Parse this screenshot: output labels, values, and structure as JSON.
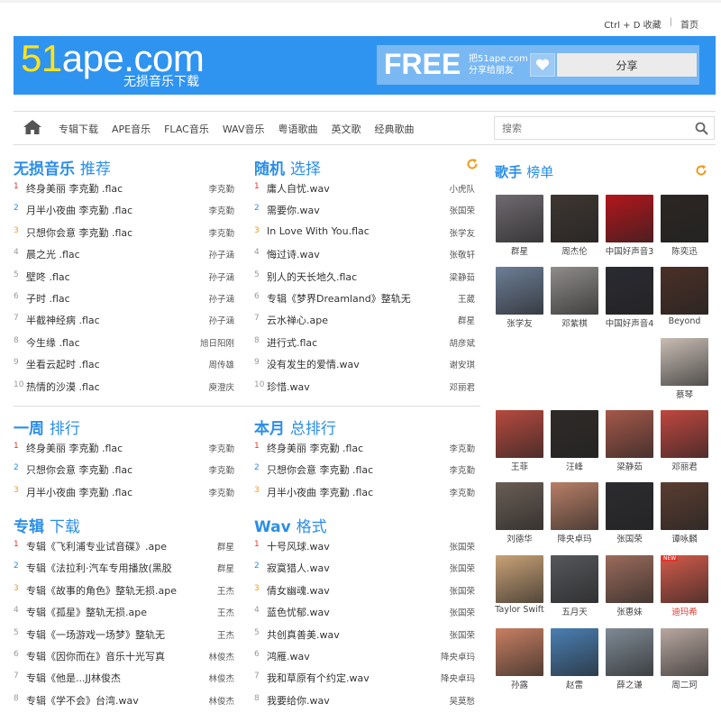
{
  "top_links": {
    "bookmark": "Ctrl + D 收藏",
    "sep": "|",
    "home": "首页"
  },
  "banner": {
    "logo_num": "51",
    "logo_text": "ape.com",
    "logo_sub": "无损音乐下载",
    "free": "FREE",
    "free_line1": "把51ape.com",
    "free_line2": "分享给朋友",
    "share": "分享"
  },
  "nav": {
    "items": [
      "专辑下载",
      "APE音乐",
      "FLAC音乐",
      "WAV音乐",
      "粤语歌曲",
      "英文歌",
      "经典歌曲"
    ],
    "search_placeholder": "搜索"
  },
  "sections": [
    {
      "title_a": "无损音乐",
      "title_b": "推荐",
      "items": [
        {
          "n": "1",
          "t": "终身美丽 李克勤 .flac",
          "a": "李克勤"
        },
        {
          "n": "2",
          "t": "月半小夜曲 李克勤 .flac",
          "a": "李克勤"
        },
        {
          "n": "3",
          "t": "只想你会意 李克勤 .flac",
          "a": "李克勤"
        },
        {
          "n": "4",
          "t": "晨之光 .flac",
          "a": "孙子涵"
        },
        {
          "n": "5",
          "t": "壁咚 .flac",
          "a": "孙子涵"
        },
        {
          "n": "6",
          "t": "子时 .flac",
          "a": "孙子涵"
        },
        {
          "n": "7",
          "t": "半截神经病 .flac",
          "a": "孙子涵"
        },
        {
          "n": "8",
          "t": "今生缘 .flac",
          "a": "旭日阳刚"
        },
        {
          "n": "9",
          "t": "坐看云起时 .flac",
          "a": "周传雄"
        },
        {
          "n": "10",
          "t": "热情的沙漠 .flac",
          "a": "庾澄庆"
        }
      ]
    },
    {
      "title_a": "随机",
      "title_b": "选择",
      "items": [
        {
          "n": "1",
          "t": "庸人自忧.wav",
          "a": "小虎队"
        },
        {
          "n": "2",
          "t": "需要你.wav",
          "a": "张国荣"
        },
        {
          "n": "3",
          "t": "In Love With You.flac",
          "a": "张学友"
        },
        {
          "n": "4",
          "t": "悔过诗.wav",
          "a": "张敬轩"
        },
        {
          "n": "5",
          "t": "别人的天长地久.flac",
          "a": "梁静茹"
        },
        {
          "n": "6",
          "t": "专辑《梦界Dreamland》整轨无",
          "a": "王葳"
        },
        {
          "n": "7",
          "t": "云水禅心.ape",
          "a": "群星"
        },
        {
          "n": "8",
          "t": "进行式.flac",
          "a": "胡彦斌"
        },
        {
          "n": "9",
          "t": "没有发生的爱情.wav",
          "a": "谢安琪"
        },
        {
          "n": "10",
          "t": "珍惜.wav",
          "a": "邓丽君"
        }
      ]
    },
    {
      "title_a": "一周",
      "title_b": "排行",
      "items": [
        {
          "n": "1",
          "t": "终身美丽 李克勤 .flac",
          "a": "李克勤"
        },
        {
          "n": "2",
          "t": "只想你会意 李克勤 .flac",
          "a": "李克勤"
        },
        {
          "n": "3",
          "t": "月半小夜曲 李克勤 .flac",
          "a": "李克勤"
        }
      ]
    },
    {
      "title_a": "本月",
      "title_b": "总排行",
      "items": [
        {
          "n": "1",
          "t": "终身美丽 李克勤 .flac",
          "a": "李克勤"
        },
        {
          "n": "2",
          "t": "只想你会意 李克勤 .flac",
          "a": "李克勤"
        },
        {
          "n": "3",
          "t": "月半小夜曲 李克勤 .flac",
          "a": "李克勤"
        }
      ]
    },
    {
      "title_a": "专辑",
      "title_b": "下载",
      "items": [
        {
          "n": "1",
          "t": "专辑《飞利浦专业试音碟》.ape",
          "a": "群星"
        },
        {
          "n": "2",
          "t": "专辑《法拉利·汽车专用播放(黑胶",
          "a": "群星"
        },
        {
          "n": "3",
          "t": "专辑《故事的角色》整轨无损.ape",
          "a": "王杰"
        },
        {
          "n": "4",
          "t": "专辑《孤星》整轨无损.ape",
          "a": "王杰"
        },
        {
          "n": "5",
          "t": "专辑《一场游戏一场梦》整轨无",
          "a": "王杰"
        },
        {
          "n": "6",
          "t": "专辑《因你而在》音乐十光写真",
          "a": "林俊杰"
        },
        {
          "n": "7",
          "t": "专辑《他是...JJ林俊杰",
          "a": "林俊杰"
        },
        {
          "n": "8",
          "t": "专辑《学不会》台湾.wav",
          "a": "林俊杰"
        }
      ]
    },
    {
      "title_a": "Wav",
      "title_b": "格式",
      "items": [
        {
          "n": "1",
          "t": "十号风球.wav",
          "a": "张国荣"
        },
        {
          "n": "2",
          "t": "寂寞猎人.wav",
          "a": "张国荣"
        },
        {
          "n": "3",
          "t": "倩女幽魂.wav",
          "a": "张国荣"
        },
        {
          "n": "4",
          "t": "蓝色忧郁.wav",
          "a": "张国荣"
        },
        {
          "n": "5",
          "t": "共创真善美.wav",
          "a": "张国荣"
        },
        {
          "n": "6",
          "t": "鸿雁.wav",
          "a": "降央卓玛"
        },
        {
          "n": "7",
          "t": "我和草原有个约定.wav",
          "a": "降央卓玛"
        },
        {
          "n": "8",
          "t": "我要给你.wav",
          "a": "吴莫愁"
        }
      ]
    }
  ],
  "singers": {
    "title_a": "歌手",
    "title_b": "榜单",
    "items": [
      {
        "name": "群星",
        "color": "#6f6a70"
      },
      {
        "name": "周杰伦",
        "color": "#3e3631"
      },
      {
        "name": "中国好声音3",
        "color": "#b3161c"
      },
      {
        "name": "陈奕迅",
        "color": "#2b2623"
      },
      {
        "name": "张学友",
        "color": "#6d7e96"
      },
      {
        "name": "邓紫棋",
        "color": "#8f8c8a"
      },
      {
        "name": "中国好声音4",
        "color": "#2a2a32"
      },
      {
        "name": "Beyond",
        "color": "#4a3027"
      },
      {
        "name": "蔡琴",
        "color": "#c8bdb4"
      },
      {
        "name": "王菲",
        "color": "#b74a3f"
      },
      {
        "name": "汪峰",
        "color": "#2f2a28"
      },
      {
        "name": "梁静茹",
        "color": "#a5584a"
      },
      {
        "name": "邓丽君",
        "color": "#c0473f"
      },
      {
        "name": "刘德华",
        "color": "#6a5e55"
      },
      {
        "name": "降央卓玛",
        "color": "#b87f67"
      },
      {
        "name": "张国荣",
        "color": "#2c2c30"
      },
      {
        "name": "谭咏麟",
        "color": "#5a3d31"
      },
      {
        "name": "Taylor Swift",
        "color": "#c9a277"
      },
      {
        "name": "五月天",
        "color": "#55575b"
      },
      {
        "name": "张惠妹",
        "color": "#9a6b5b"
      },
      {
        "name": "迪玛希",
        "color": "#d25a4a",
        "badge": "NEW"
      },
      {
        "name": "孙露",
        "color": "#c77f62"
      },
      {
        "name": "赵雷",
        "color": "#4a7fb3"
      },
      {
        "name": "薛之谦",
        "color": "#7f8a95"
      },
      {
        "name": "周二珂",
        "color": "#b8a7a0"
      }
    ]
  }
}
